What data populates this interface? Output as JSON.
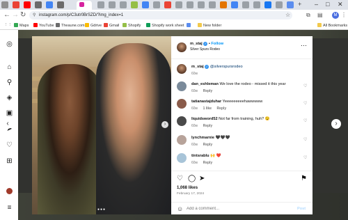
{
  "browser": {
    "url": "instagram.com/p/C3utr0BrSZD/?img_index=1",
    "bookmarks": [
      {
        "label": "Maps",
        "color": "#34a853"
      },
      {
        "label": "YouTube",
        "color": "#ff0000"
      },
      {
        "label": "Theaune.com",
        "color": "#6b6b6b"
      },
      {
        "label": "Gdrive",
        "color": "#fbbc04"
      },
      {
        "label": "Gmail",
        "color": "#ea4335"
      },
      {
        "label": "Shopify",
        "color": "#95bf47"
      },
      {
        "label": "Shopify work sheet",
        "color": "#0f9d58"
      },
      {
        "label": "",
        "color": "#5b8def"
      },
      {
        "label": "New folder",
        "color": "#f2c94c"
      }
    ],
    "all_bookmarks_label": "All Bookmarks",
    "profile_initial": "M"
  },
  "post": {
    "author": {
      "username": "m_staj",
      "follow_label": "Follow",
      "location": "Silver Spurs Rodeo",
      "separator": "•"
    },
    "caption": {
      "username": "m_staj",
      "mention": "@silverspursrodeo",
      "time": "60w"
    },
    "comments": [
      {
        "username": "dan_eshleman",
        "text": "We love the rodeo - missed it this year",
        "time": "60w",
        "likes": "",
        "reply": "Reply",
        "avatar_color": "#7a8a9a"
      },
      {
        "username": "tatianastajduhar",
        "text": "Yeeeeeeeeehawwwww",
        "time": "60w",
        "likes": "1 like",
        "reply": "Reply",
        "avatar_color": "#8a5b4a"
      },
      {
        "username": "liquidsword52",
        "text": "Not far from training, huh? 😉",
        "time": "60w",
        "likes": "",
        "reply": "Reply",
        "avatar_color": "#4a4a4a"
      },
      {
        "username": "lynchmarnie",
        "text": "🖤🖤🖤",
        "time": "60w",
        "likes": "",
        "reply": "Reply",
        "avatar_color": "#b7a39a"
      },
      {
        "username": "tintsrablu",
        "text": "🙌 ❤️",
        "time": "60w",
        "likes": "",
        "reply": "Reply",
        "avatar_color": "#a8c4d8"
      }
    ],
    "likes_count": "1,068 likes",
    "date": "February 17, 2024",
    "add_comment_placeholder": "Add a comment...",
    "post_button": "Post"
  },
  "icons": {
    "sidebar": [
      "instagram-icon",
      "home-icon",
      "search-icon",
      "explore-icon",
      "reels-icon",
      "messages-icon",
      "notifications-icon",
      "create-icon",
      "profile-icon",
      "menu-icon"
    ],
    "actions": [
      "heart-icon",
      "comment-icon",
      "share-icon",
      "bookmark-icon"
    ]
  },
  "colors": {
    "link": "#0095f6",
    "verified": "#3897f0",
    "post_disabled": "#b3dbff"
  }
}
